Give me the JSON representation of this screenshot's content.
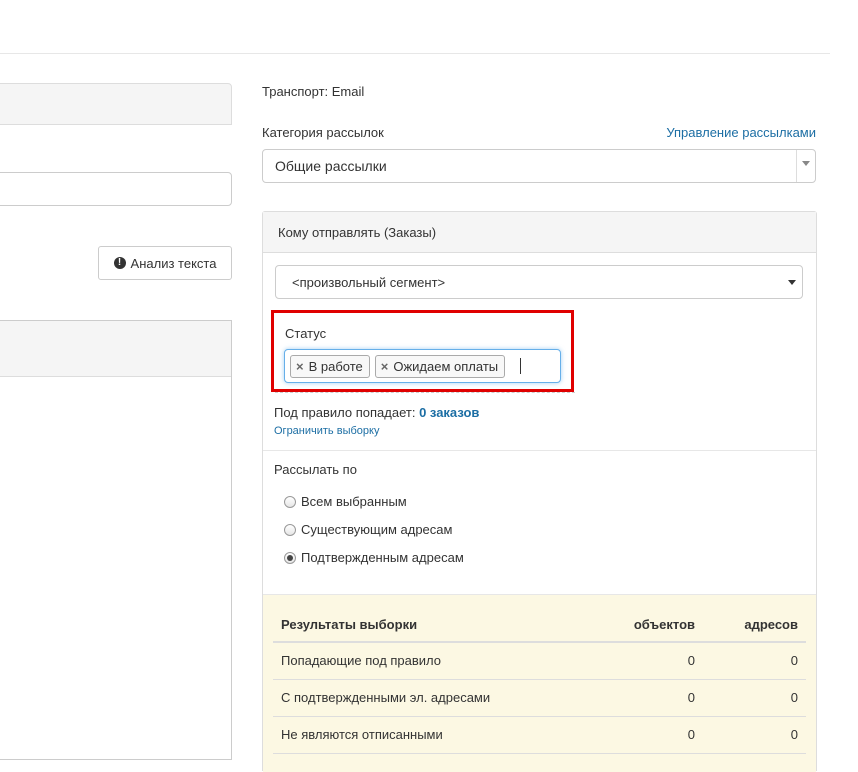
{
  "left": {
    "analyze_button": "Анализ текста"
  },
  "transport": "Транспорт: Email",
  "category": {
    "label": "Категория рассылок",
    "manage_link": "Управление рассылками",
    "value": "Общие рассылки"
  },
  "send_panel": {
    "title": "Кому отправлять (Заказы)",
    "segment_value": "<произвольный сегмент>",
    "status_label": "Статус",
    "tags": [
      "В работе",
      "Ожидаем оплаты"
    ],
    "match_prefix": "Под правило попадает: ",
    "match_count": "0 заказов",
    "limit_link": "Ограничить выборку",
    "send_by_label": "Рассылать по",
    "radios": [
      {
        "label": "Всем выбранным",
        "checked": false
      },
      {
        "label": "Существующим адресам",
        "checked": false
      },
      {
        "label": "Подтвержденным адресам",
        "checked": true
      }
    ]
  },
  "results": {
    "headers": [
      "Результаты выборки",
      "объектов",
      "адресов"
    ],
    "rows": [
      [
        "Попадающие под правило",
        "0",
        "0"
      ],
      [
        "С подтвержденными эл. адресами",
        "0",
        "0"
      ],
      [
        "Не являются отписанными",
        "0",
        "0"
      ]
    ]
  }
}
